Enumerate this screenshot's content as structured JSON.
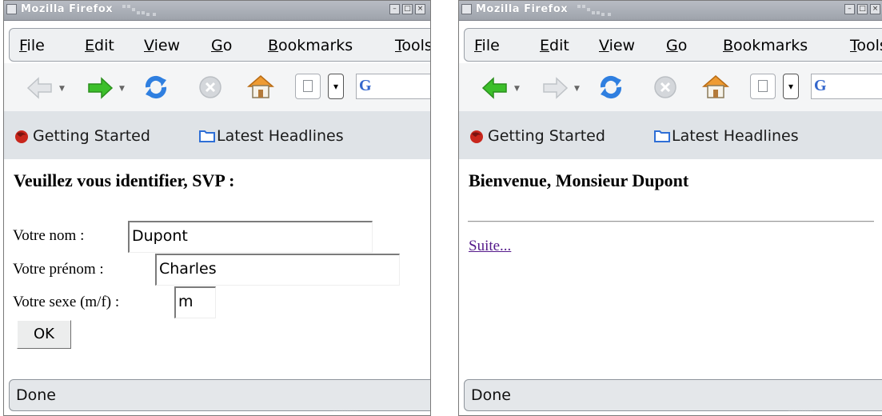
{
  "windows": [
    {
      "title": "Mozilla Firefox",
      "menu": [
        "File",
        "Edit",
        "View",
        "Go",
        "Bookmarks",
        "Tools"
      ],
      "bookmarks": [
        "Getting Started",
        "Latest Headlines"
      ],
      "content": {
        "heading": "Veuillez vous identifier, SVP :",
        "fields": [
          {
            "label": "Votre nom :",
            "value": "Dupont"
          },
          {
            "label": "Votre prénom :",
            "value": "Charles"
          },
          {
            "label": "Votre sexe (m/f) :",
            "value": "m"
          }
        ],
        "button": "OK"
      },
      "back_enabled": false,
      "forward_enabled": true,
      "status": "Done"
    },
    {
      "title": "Mozilla Firefox",
      "menu": [
        "File",
        "Edit",
        "View",
        "Go",
        "Bookmarks",
        "Tools"
      ],
      "bookmarks": [
        "Getting Started",
        "Latest Headlines"
      ],
      "content": {
        "heading": "Bienvenue, Monsieur Dupont",
        "link": "Suite..."
      },
      "back_enabled": true,
      "forward_enabled": false,
      "status": "Done"
    }
  ],
  "icons": [
    "back-arrow-icon",
    "forward-arrow-icon",
    "reload-icon",
    "stop-icon",
    "home-icon",
    "page-icon",
    "google-icon",
    "firefox-icon",
    "folder-icon"
  ],
  "colors": {
    "visited_link": "#551a8b",
    "arrow_enabled": "#3cbf2a",
    "arrow_disabled": "#bfc3c7"
  }
}
